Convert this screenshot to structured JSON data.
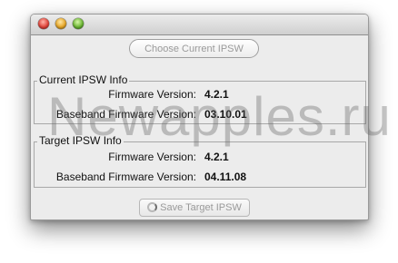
{
  "buttons": {
    "choose_ipsw": "Choose Current IPSW",
    "save_ipsw": "Save Target IPSW"
  },
  "current": {
    "title": "Current IPSW Info",
    "firmware_label": "Firmware Version:",
    "firmware_value": "4.2.1",
    "baseband_label": "Baseband Firmware Version:",
    "baseband_value": "03.10.01"
  },
  "target": {
    "title": "Target IPSW Info",
    "firmware_label": "Firmware Version:",
    "firmware_value": "4.2.1",
    "baseband_label": "Baseband Firmware Version:",
    "baseband_value": "04.11.08"
  },
  "watermark": "Newapples.ru",
  "colors": {
    "window_bg": "#ececec",
    "close": "#e0443a",
    "minimize": "#e7a728",
    "zoom": "#6cb634"
  },
  "icons": [
    "close-icon",
    "minimize-icon",
    "zoom-icon",
    "spinner-icon"
  ]
}
